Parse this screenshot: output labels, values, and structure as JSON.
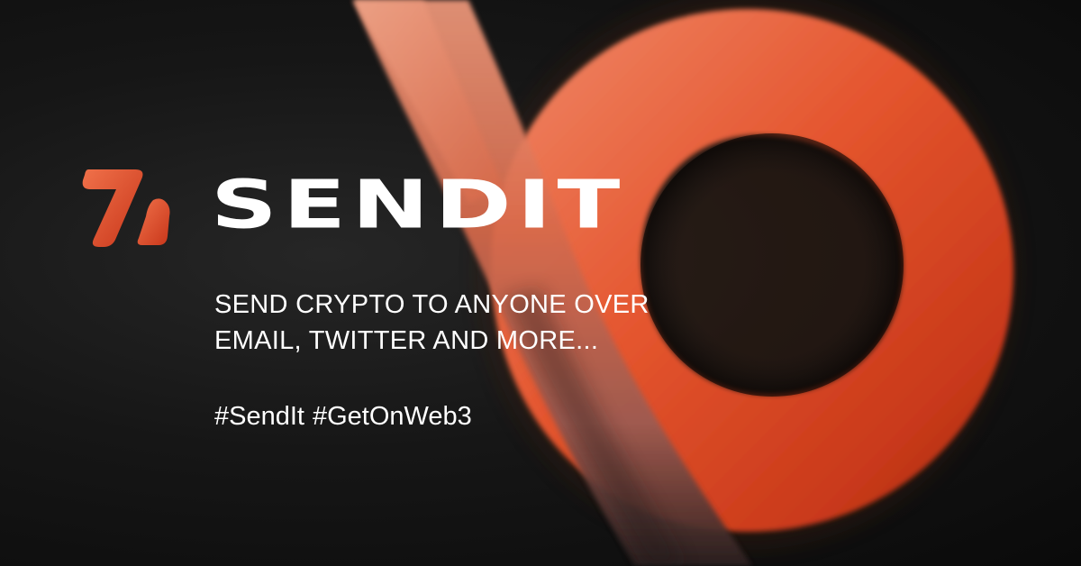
{
  "brand": {
    "name": "SENDIT",
    "logo_icon": "sendit-logo-icon",
    "accent_color": "#d9461f"
  },
  "tagline": {
    "line1": "SEND CRYPTO TO ANYONE OVER",
    "line2": "EMAIL, TWITTER AND MORE..."
  },
  "hashtags": [
    "#SendIt",
    "#GetOnWeb3"
  ],
  "colors": {
    "background": "#111111",
    "text": "#ffffff",
    "ribbon": "#d9461f"
  }
}
